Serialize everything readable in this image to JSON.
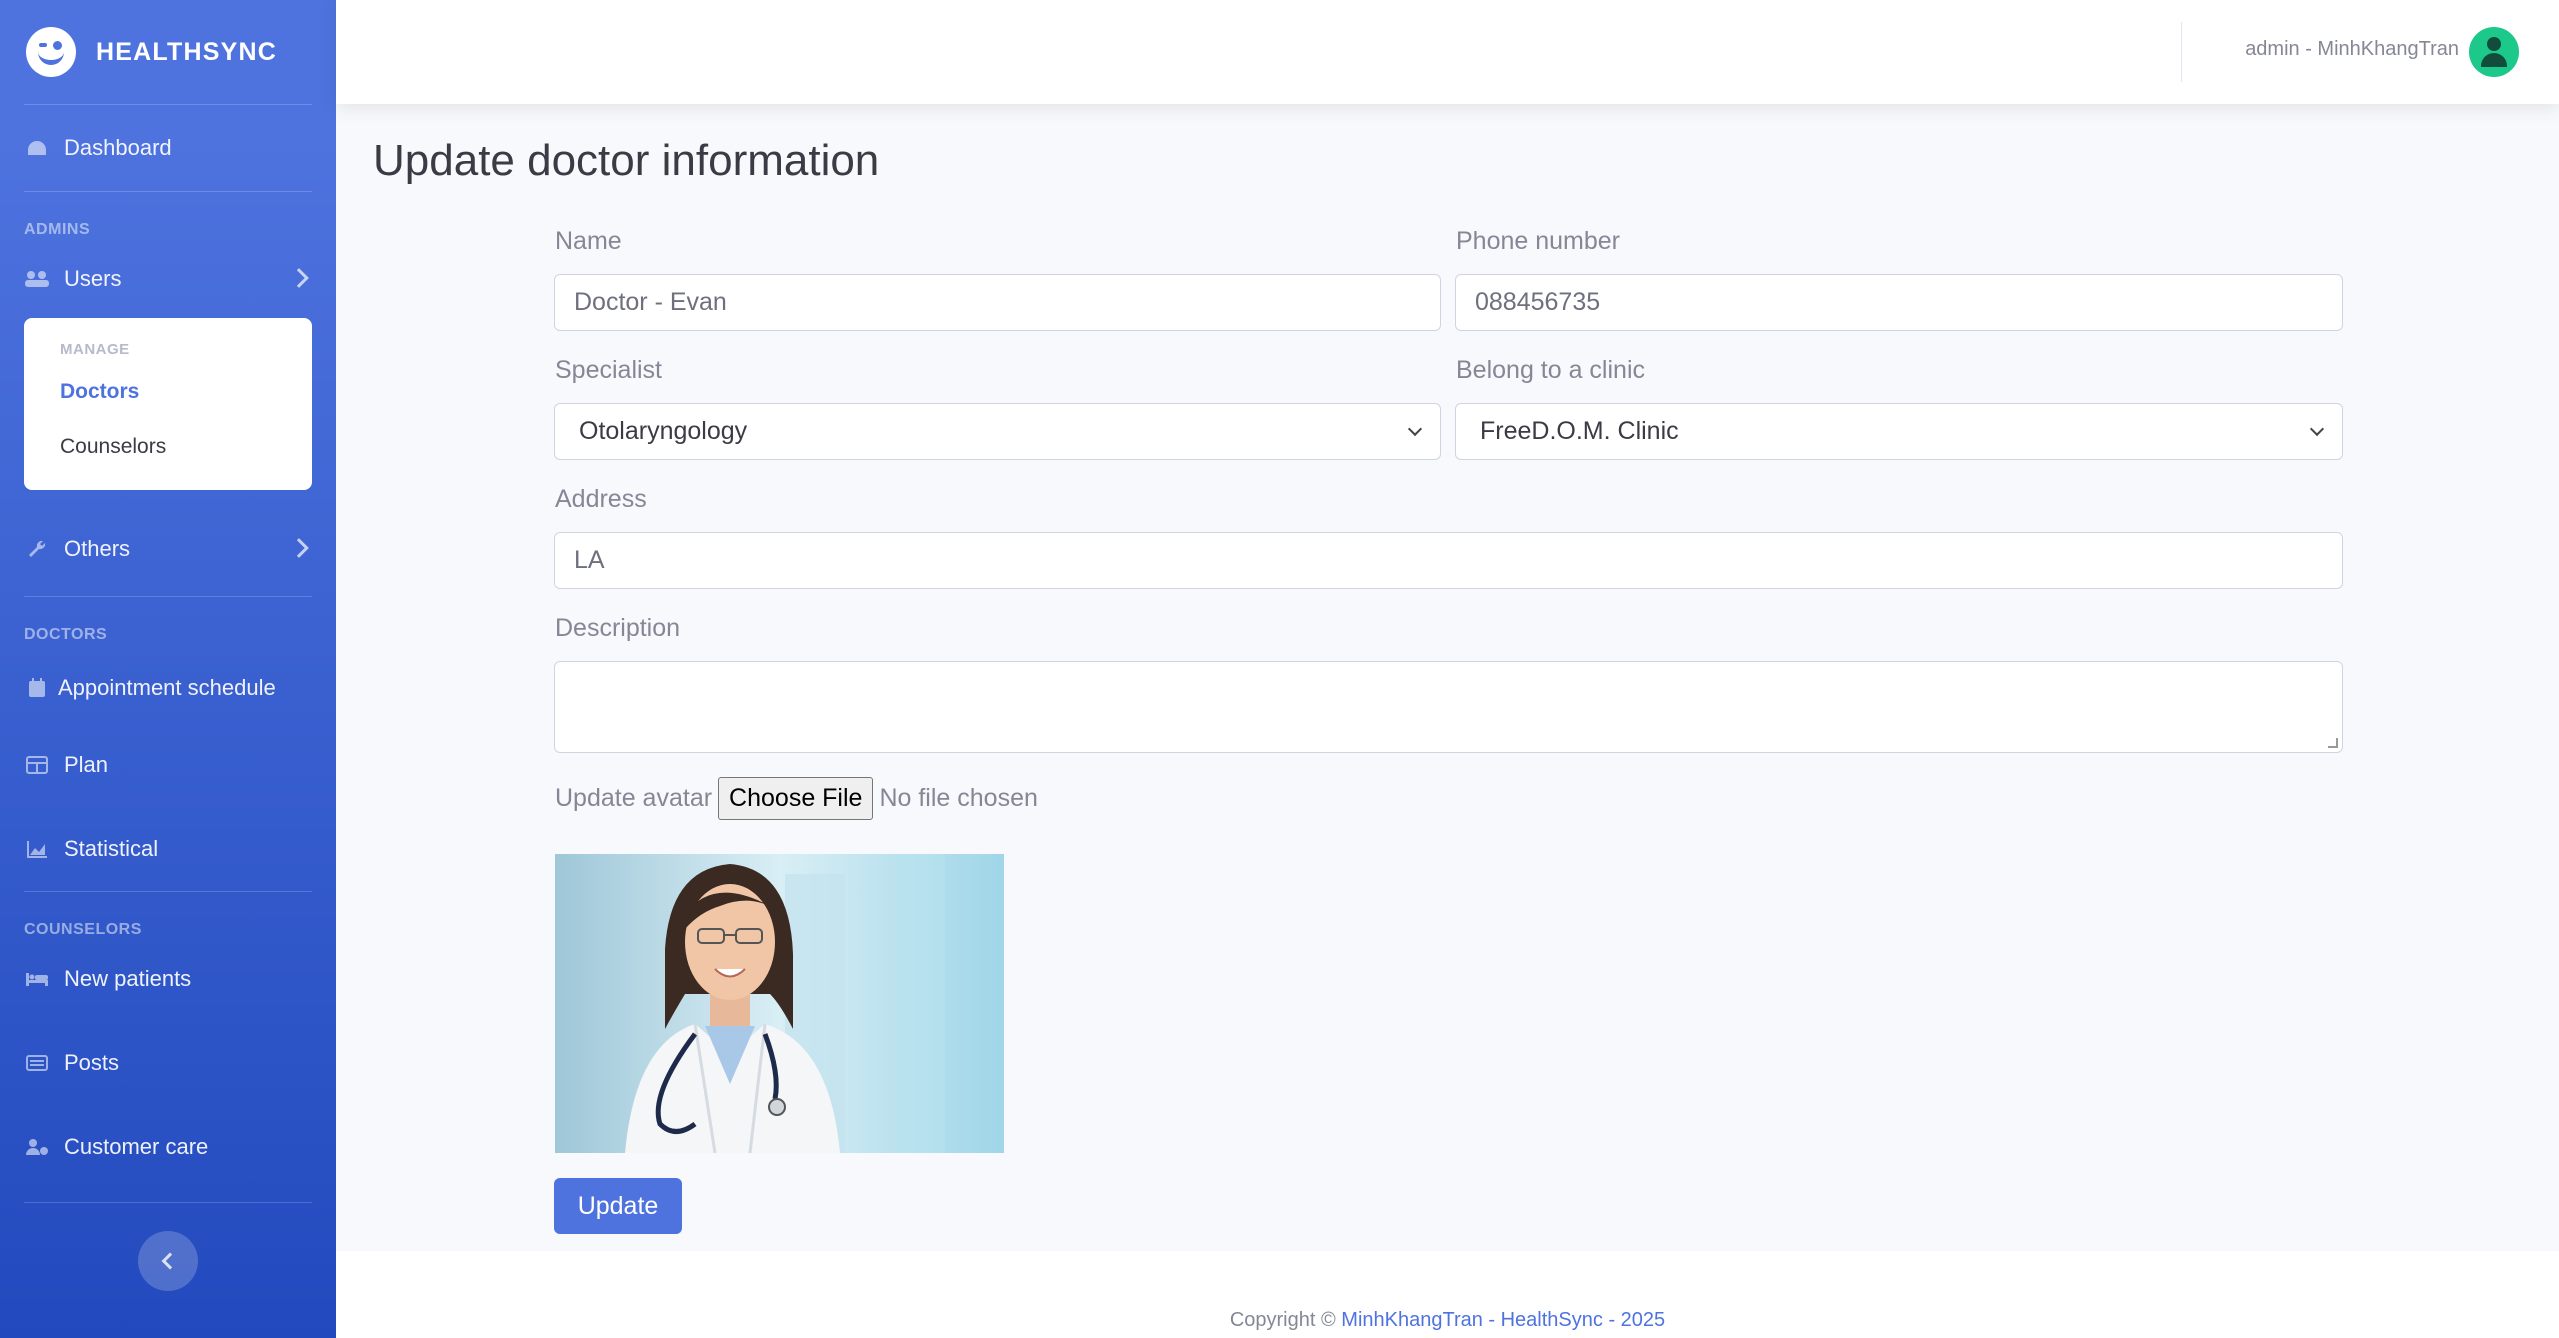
{
  "brand": {
    "name": "HEALTHSYNC"
  },
  "sidebar": {
    "dashboard": "Dashboard",
    "heading_admins": "ADMINS",
    "users": "Users",
    "manage_header": "MANAGE",
    "manage_items": [
      "Doctors",
      "Counselors"
    ],
    "others": "Others",
    "heading_doctors": "DOCTORS",
    "appointment": "Appointment schedule",
    "plan": "Plan",
    "statistical": "Statistical",
    "heading_counselors": "COUNSELORS",
    "new_patients": "New patients",
    "posts": "Posts",
    "customer_care": "Customer care"
  },
  "topbar": {
    "user": "admin - MinhKhangTran"
  },
  "form": {
    "title": "Update doctor information",
    "name_label": "Name",
    "name_value": "Doctor - Evan",
    "phone_label": "Phone number",
    "phone_value": "088456735",
    "specialist_label": "Specialist",
    "specialist_value": "Otolaryngology",
    "clinic_label": "Belong to a clinic",
    "clinic_value": "FreeD.O.M. Clinic",
    "address_label": "Address",
    "address_value": "LA",
    "description_label": "Description",
    "description_value": "",
    "avatar_label": "Update avatar",
    "choose_file": "Choose File",
    "file_status": "No file chosen",
    "update_button": "Update"
  },
  "footer": {
    "prefix": "Copyright ©",
    "link": "MinhKhangTran - HealthSync - 2025"
  },
  "colors": {
    "primary": "#4e73df",
    "sidebar_end": "#224abe",
    "avatar_bg": "#1cc88a"
  }
}
